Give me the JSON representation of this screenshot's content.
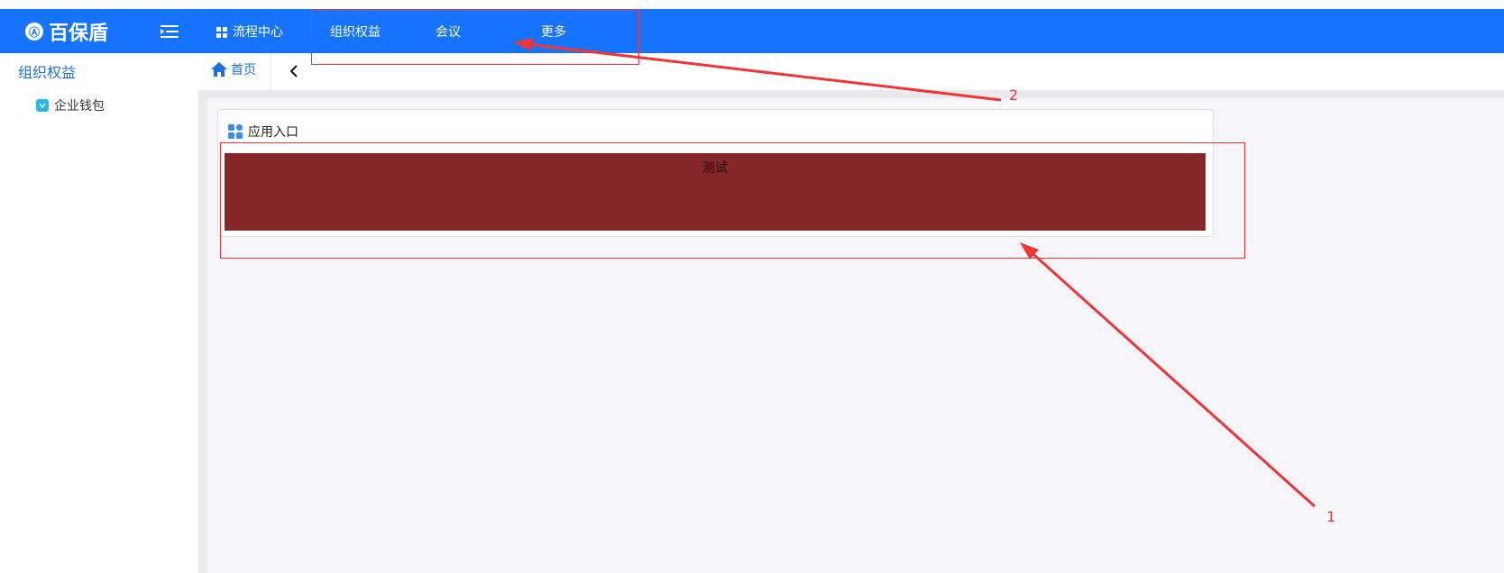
{
  "header": {
    "logo_badge": "Ⓐ",
    "logo_text": "百保盾",
    "nav": [
      {
        "label": "流程中心"
      },
      {
        "label": "组织权益"
      },
      {
        "label": "会议"
      },
      {
        "label": "更多"
      }
    ],
    "color": "#1573fe"
  },
  "sidebar": {
    "title": "组织权益",
    "items": [
      {
        "label": "企业钱包",
        "icon": "wallet-icon"
      }
    ]
  },
  "tabs": {
    "home_label": "首页"
  },
  "card": {
    "title": "应用入口",
    "tile_label": "测试",
    "tile_color": "#852629"
  },
  "annotations": {
    "label_1": "1",
    "label_2": "2",
    "color": "#ef3535"
  }
}
